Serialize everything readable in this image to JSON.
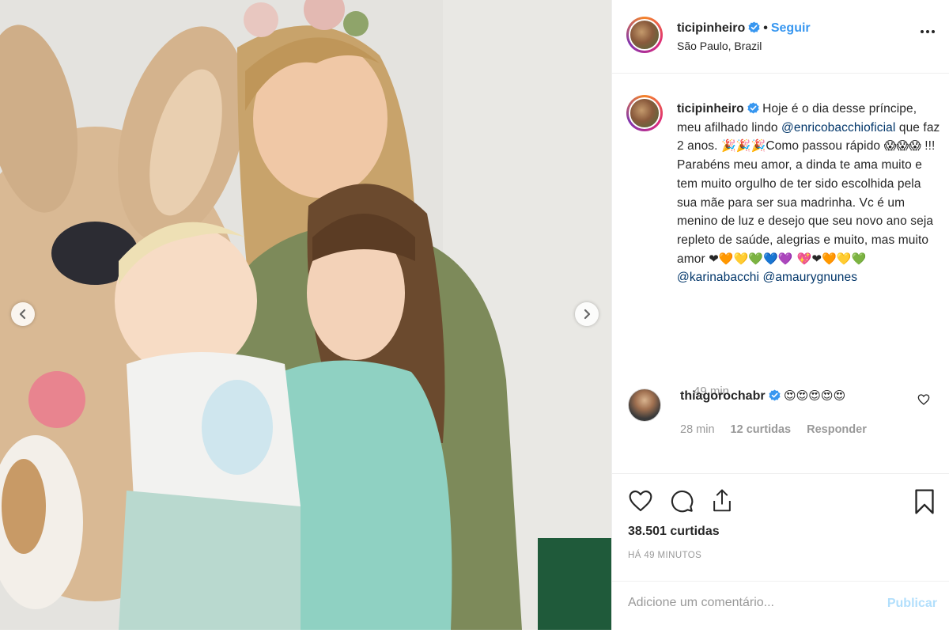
{
  "colors": {
    "accent": "#3897f0",
    "mention": "#003569",
    "muted": "#999999",
    "publish_disabled": "#b2dffc"
  },
  "photo": {
    "prev_icon": "chevron-left-icon",
    "next_icon": "chevron-right-icon"
  },
  "header": {
    "username": "ticipinheiro",
    "separator": "•",
    "follow_label": "Seguir",
    "location": "São Paulo, Brazil",
    "more_icon": "more-options-icon"
  },
  "caption": {
    "username": "ticipinheiro",
    "text_1": "Hoje é o dia desse príncipe, meu afilhado lindo",
    "mention_1": "@enricobacchioficial",
    "text_2": "que faz 2 anos.",
    "emoji_1": "🎉🎉🎉",
    "text_3": "Como passou rápido",
    "emoji_2": "😱😱😱",
    "text_4": "!!! Parabéns meu amor, a dinda te ama muito e tem muito orgulho de ter sido escolhida pela sua mãe para ser sua madrinha. Vc é um menino de luz e desejo que seu novo ano seja repleto de saúde, alegrias e muito, mas muito amor",
    "emoji_3": "❤🧡💛💚💙💜 💖❤🧡💛💚",
    "mention_2": "@karinabacchi",
    "mention_3": "@amaurygnunes",
    "time": "49 min"
  },
  "reply": {
    "username": "thiagorochabr",
    "emoji": "😍😍😍😍😍",
    "time": "28 min",
    "likes": "12 curtidas",
    "reply_label": "Responder"
  },
  "actions": {
    "like_icon": "heart-icon",
    "comment_icon": "comment-icon",
    "share_icon": "share-icon",
    "save_icon": "bookmark-icon",
    "likes": "38.501 curtidas",
    "posted": "HÁ 49 MINUTOS"
  },
  "comment_box": {
    "placeholder": "Adicione um comentário...",
    "publish_label": "Publicar"
  }
}
